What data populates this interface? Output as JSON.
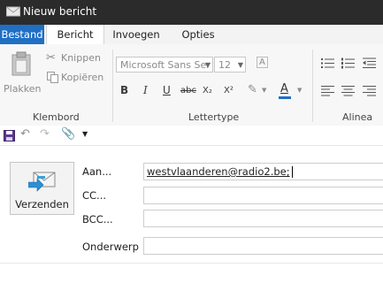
{
  "window": {
    "title": "Nieuw bericht"
  },
  "tabs": [
    {
      "label": "Bestand",
      "active": false
    },
    {
      "label": "Bericht",
      "active": true
    },
    {
      "label": "Invoegen",
      "active": false
    },
    {
      "label": "Opties",
      "active": false
    }
  ],
  "ribbon": {
    "clipboard": {
      "paste_label": "Plakken",
      "cut_label": "Knippen",
      "copy_label": "Kopiëren",
      "group_label": "Klembord"
    },
    "font": {
      "font_name": "Microsoft Sans Ser",
      "font_size": "12",
      "group_label": "Lettertype",
      "bold": "B",
      "italic": "I",
      "underline": "U",
      "strike": "abc",
      "subscript": "X₂",
      "superscript": "X²",
      "color_letter": "A"
    },
    "paragraph": {
      "group_label": "Alinea"
    }
  },
  "compose": {
    "send_label": "Verzenden",
    "to_label": "Aan...",
    "cc_label": "CC...",
    "bcc_label": "BCC...",
    "subject_label": "Onderwerp",
    "to_value": "westvlaanderen@radio2.be;",
    "cc_value": "",
    "bcc_value": "",
    "subject_value": ""
  },
  "colors": {
    "file_tab": "#1f6fc5",
    "titlebar": "#2b2b2b",
    "font_color_bar": "#1f6fc5"
  }
}
